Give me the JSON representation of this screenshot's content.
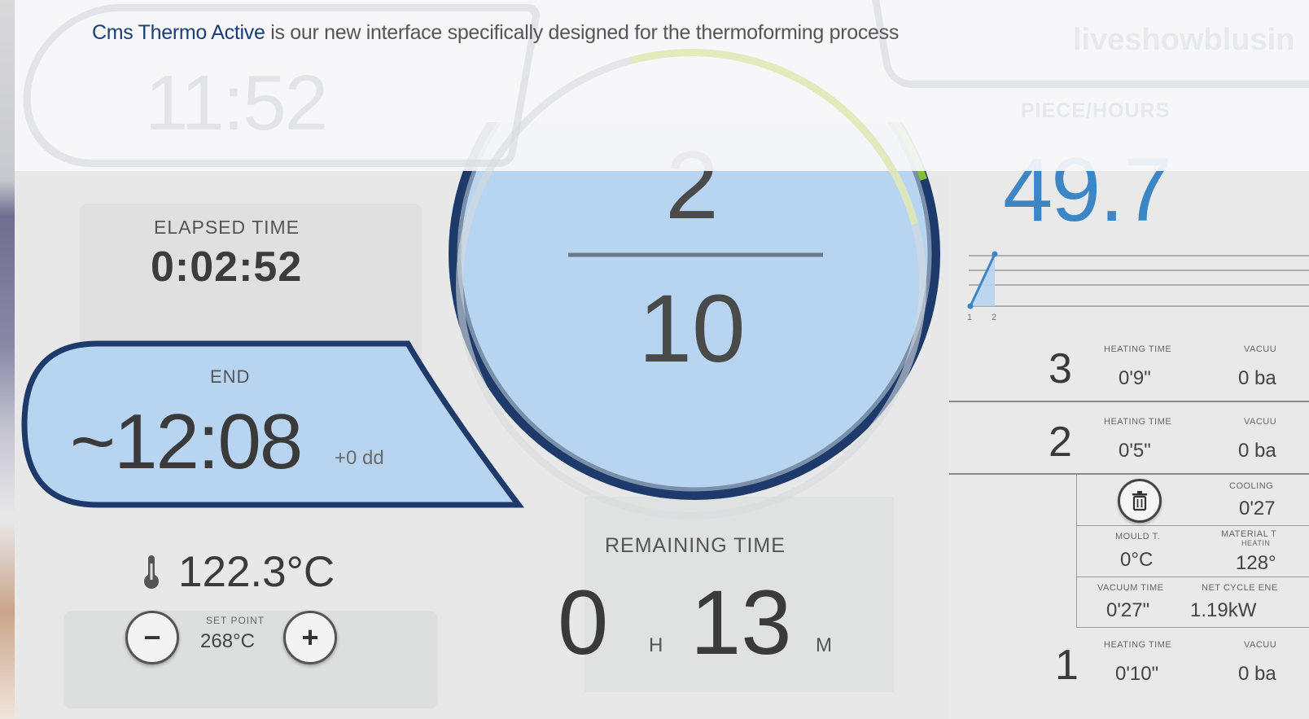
{
  "banner": {
    "brand": "Cms Thermo Active",
    "text": " is our new interface specifically designed for the thermoforming process",
    "ghost_clock": "11:52",
    "ghost_right": "liveshowblusin",
    "ghost_piece_hours": "PIECE/HOURS"
  },
  "elapsed": {
    "label": "ELAPSED TIME",
    "value": "0:02:52"
  },
  "end": {
    "label": "END",
    "value": "~12:08",
    "extra": "+0 dd"
  },
  "temperature": {
    "value": "122.3°C",
    "setpoint_label": "SET POINT",
    "setpoint_value": "268°C",
    "minus": "−",
    "plus": "+"
  },
  "dial": {
    "numerator": "2",
    "denominator": "10",
    "progress": 0.2
  },
  "remaining": {
    "label": "REMAINING TIME",
    "hours": "0",
    "hours_unit": "H",
    "minutes": "13",
    "minutes_unit": "M"
  },
  "right": {
    "pieces_per_hour": "49.7",
    "spark_ticks": [
      "1",
      "2"
    ],
    "cycles": [
      {
        "num": "3",
        "heating_label": "HEATING TIME",
        "heating": "0'9\"",
        "vacuum_label": "VACUU",
        "vacuum": "0 ba"
      },
      {
        "num": "2",
        "heating_label": "HEATING TIME",
        "heating": "0'5\"",
        "vacuum_label": "VACUU",
        "vacuum": "0 ba"
      },
      {
        "num": "1",
        "heating_label": "HEATING TIME",
        "heating": "0'10\"",
        "vacuum_label": "VACUU",
        "vacuum": "0 ba"
      }
    ],
    "details": {
      "cooling_label": "COOLING",
      "cooling": "0'27",
      "mould_label": "MOULD T.",
      "mould": "0°C",
      "material_label": "MATERIAL T",
      "material_sub": "HEATIN",
      "material": "128°",
      "vacuum_time_label": "VACUUM TIME",
      "vacuum_time": "0'27\"",
      "energy_label": "NET CYCLE ENE",
      "energy": "1.19kW"
    }
  },
  "colors": {
    "accent_blue": "#3d86c6",
    "navy": "#1a3e78",
    "pill_fill": "#b7d4f1",
    "dial_ring": "#1d3a6b",
    "dial_green": "#7fbf3f"
  }
}
